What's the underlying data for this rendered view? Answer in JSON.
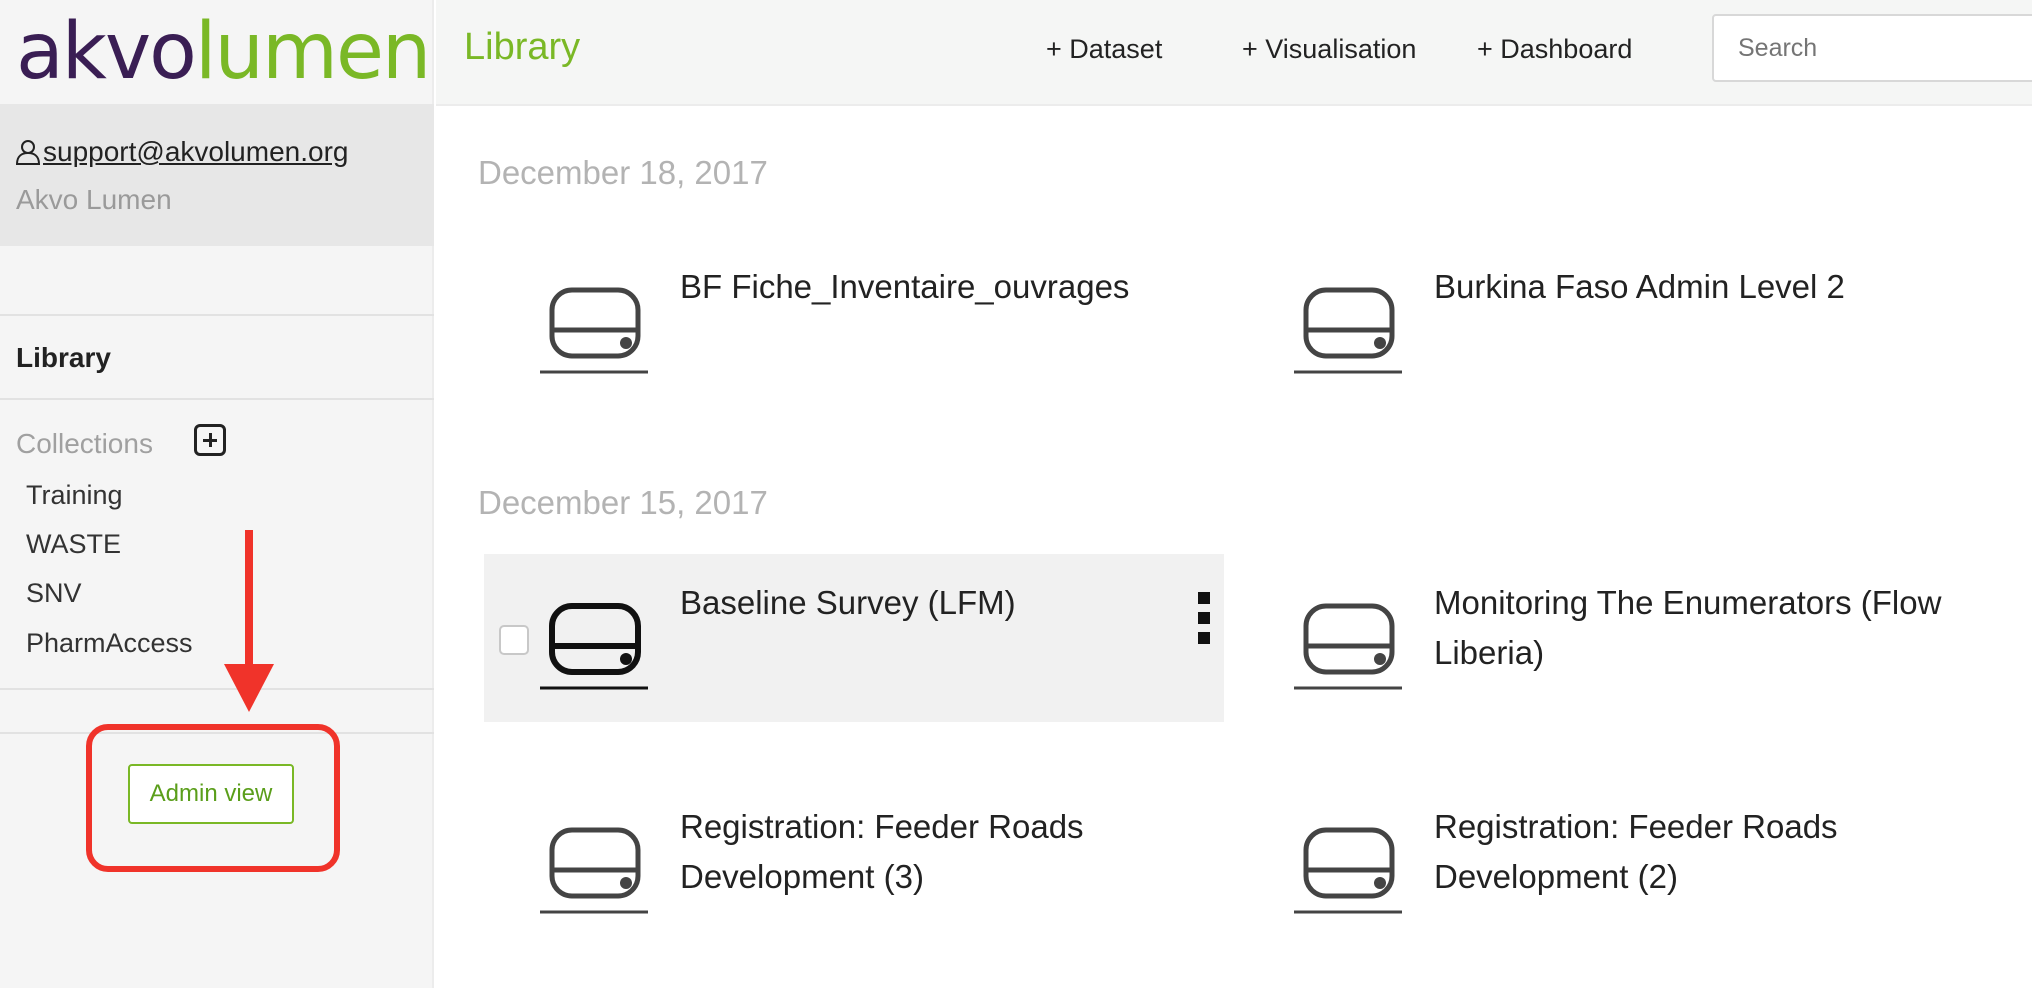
{
  "brand": {
    "logo_part1": "akvo",
    "logo_part2": "lumen"
  },
  "user": {
    "email": "support@akvolumen.org",
    "org": "Akvo Lumen"
  },
  "nav": {
    "library_label": "Library",
    "collections_label": "Collections",
    "collections": [
      "Training",
      "WASTE",
      "SNV",
      "PharmAccess"
    ],
    "admin_view_label": "Admin view"
  },
  "header": {
    "title": "Library",
    "actions": [
      "+ Dataset",
      "+ Visualisation",
      "+ Dashboard"
    ],
    "search_placeholder": "Search"
  },
  "library": {
    "groups": [
      {
        "date": "December 18, 2017",
        "items": [
          "BF Fiche_Inventaire_ouvrages",
          "Burkina Faso Admin Level 2"
        ]
      },
      {
        "date": "December 15, 2017",
        "items": [
          "Baseline Survey (LFM)",
          "Monitoring The Enumerators (Flow Liberia)",
          "Registration: Feeder Roads Development (3)",
          "Registration: Feeder Roads Development (2)"
        ]
      }
    ]
  },
  "icons": {
    "dataset": "hard-drive-icon",
    "user": "user-icon",
    "add": "plus-square-icon",
    "menu": "kebab-menu-icon"
  },
  "colors": {
    "brand_purple": "#3a1e54",
    "brand_green": "#7ab826",
    "highlight_red": "#f0332a"
  }
}
